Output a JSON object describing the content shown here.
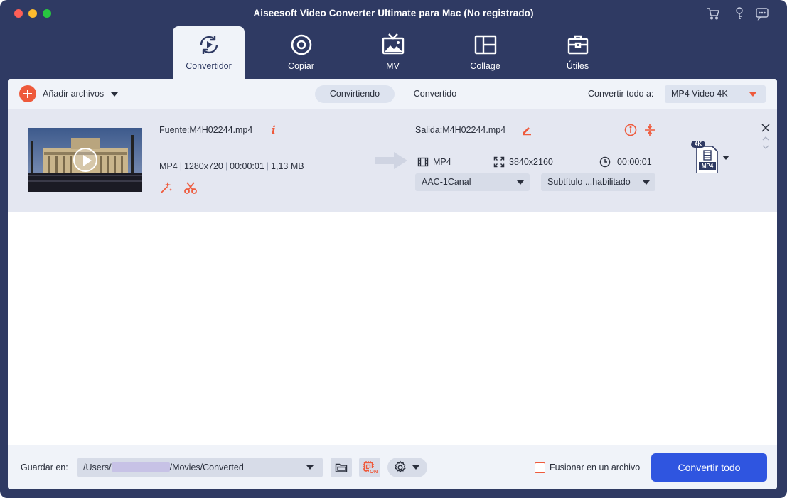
{
  "window": {
    "title": "Aiseesoft Video Converter Ultimate para Mac (No registrado)"
  },
  "nav": {
    "tabs": [
      {
        "label": "Convertidor",
        "icon": "convert-icon",
        "active": true
      },
      {
        "label": "Copiar",
        "icon": "disc-icon",
        "active": false
      },
      {
        "label": "MV",
        "icon": "tv-icon",
        "active": false
      },
      {
        "label": "Collage",
        "icon": "collage-icon",
        "active": false
      },
      {
        "label": "Útiles",
        "icon": "toolbox-icon",
        "active": false
      }
    ]
  },
  "toolbar": {
    "add_label": "Añadir archivos",
    "segments": [
      {
        "label": "Convirtiendo",
        "active": true
      },
      {
        "label": "Convertido",
        "active": false
      }
    ],
    "convert_all_label": "Convertir todo a:",
    "convert_all_value": "MP4 Video 4K"
  },
  "file": {
    "source_label": "Fuente:M4H02244.mp4",
    "source_meta": {
      "format": "MP4",
      "resolution": "1280x720",
      "duration": "00:00:01",
      "size": "1,13 MB"
    },
    "output_label": "Salida:M4H02244.mp4",
    "output_meta": {
      "format": "MP4",
      "resolution": "3840x2160",
      "duration": "00:00:01"
    },
    "audio_value": "AAC-1Canal",
    "subtitle_value": "Subtítulo ...habilitado",
    "format_badge": {
      "top": "4K",
      "bottom": "MP4"
    }
  },
  "bottom": {
    "save_label": "Guardar en:",
    "path_prefix": "/Users/",
    "path_suffix": "/Movies/Converted",
    "merge_label": "Fusionar en un archivo",
    "merge_checked": false,
    "convert_button": "Convertir todo",
    "gpu_badge": "ON"
  },
  "colors": {
    "frame": "#2f3a63",
    "accent": "#ee5a3c",
    "primary": "#2f55e0",
    "row_bg": "#e4e7f1"
  }
}
